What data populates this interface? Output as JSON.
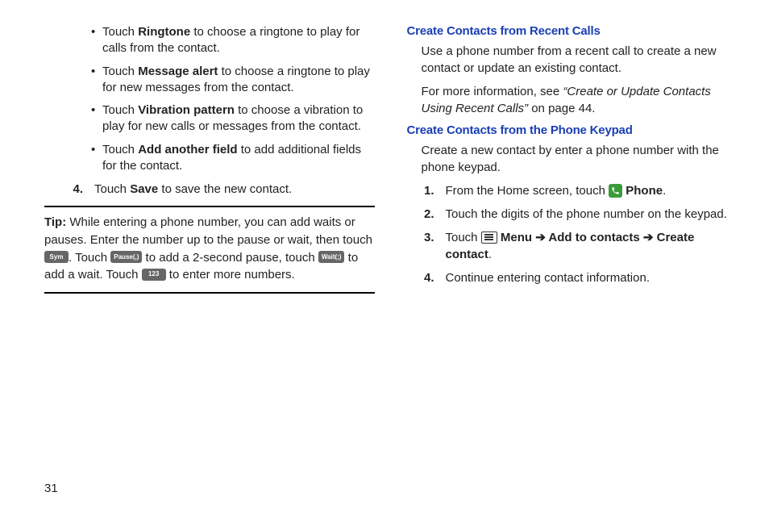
{
  "page_number": "31",
  "left": {
    "bullets": [
      {
        "pre": "Touch ",
        "bold": "Ringtone",
        "post": " to choose a ringtone to play for calls from the contact."
      },
      {
        "pre": "Touch ",
        "bold": "Message alert",
        "post": " to choose a ringtone to play for new messages from the contact."
      },
      {
        "pre": "Touch ",
        "bold": "Vibration pattern",
        "post": " to choose a vibration to play for new calls or messages from the contact."
      },
      {
        "pre": "Touch ",
        "bold": "Add another field",
        "post": " to add additional fields for the contact."
      }
    ],
    "step4": {
      "num": "4.",
      "pre": "Touch ",
      "bold": "Save",
      "post": " to save the new contact."
    },
    "tip": {
      "label": "Tip: ",
      "t1": "While entering a phone number, you can add waits or pauses. Enter the number up to the pause or wait, then touch ",
      "k1": "Sym",
      "t2": ". Touch ",
      "k2": "Pause(,)",
      "t3": " to add a 2-second pause, touch ",
      "k3": "Wait(;)",
      "t4": " to add a wait. Touch ",
      "k4": "123",
      "t5": " to enter more numbers."
    }
  },
  "right": {
    "h1": "Create Contacts from Recent Calls",
    "p1": "Use a phone number from a recent call to create a new contact or update an existing contact.",
    "p2a": "For more information, see ",
    "p2b": "“Create or Update Contacts Using Recent Calls”",
    "p2c": " on page 44.",
    "h2": "Create Contacts from the Phone Keypad",
    "p3": "Create a new contact by enter a phone number with the phone keypad.",
    "steps": [
      {
        "num": "1.",
        "pre": "From the Home screen, touch ",
        "icon": "phone",
        "bold": " Phone",
        "post": "."
      },
      {
        "num": "2.",
        "pre": "Touch the digits of the phone number on the keypad.",
        "post": ""
      },
      {
        "num": "3.",
        "pre": "Touch ",
        "icon": "menu",
        "bold": " Menu ➔ Add to contacts ➔ Create contact",
        "post": "."
      },
      {
        "num": "4.",
        "pre": "Continue entering contact information.",
        "post": ""
      }
    ]
  }
}
